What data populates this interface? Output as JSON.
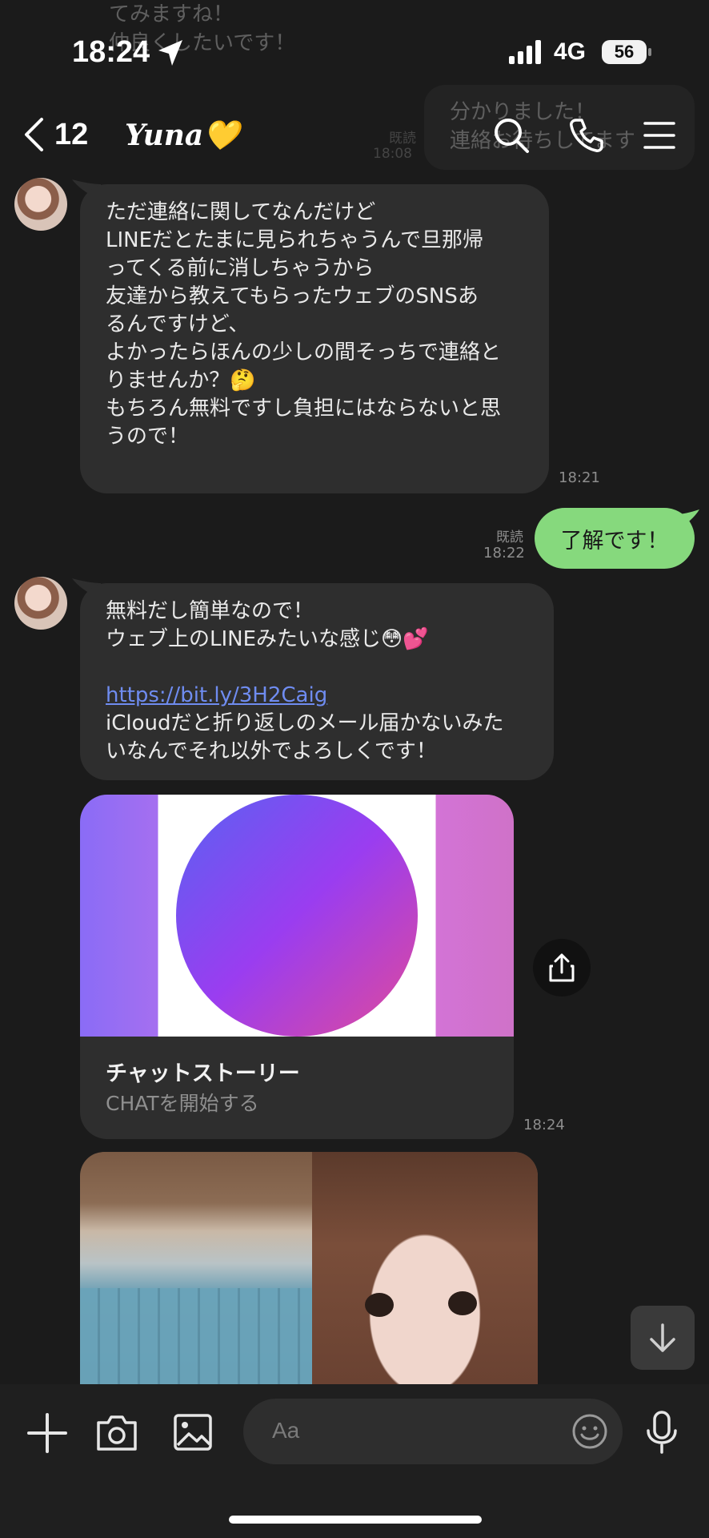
{
  "status": {
    "time": "18:24",
    "network": "4G",
    "battery": "56"
  },
  "background": {
    "line1": "てみますね！",
    "line2": "仲良くしたいです！",
    "bubble_line1": "分かりました！",
    "bubble_line2": "連絡お待ちしてます",
    "read": "既読",
    "time": "18:08"
  },
  "header": {
    "back_count": "12",
    "name": "Yuna💛"
  },
  "messages": {
    "m1": {
      "lines": [
        "ただ連絡に関してなんだけど",
        "LINEだとたまに見られちゃうんで旦那帰",
        "ってくる前に消しちゃうから",
        "友達から教えてもらったウェブのSNSあ",
        "るんですけど、",
        "よかったらほんの少しの間そっちで連絡と",
        "りませんか？🤔",
        "もちろん無料ですし負担にはならないと思",
        "うので！"
      ],
      "time": "18:21"
    },
    "m2": {
      "text": "了解です！",
      "read": "既読",
      "time": "18:22"
    },
    "m3": {
      "line1": "無料だし簡単なので！",
      "line2": "ウェブ上のLINEみたいな感じ😳💕",
      "link": "https://bit.ly/3H2Caig",
      "line3": "iCloudだと折り返しのメール届かないみた",
      "line4": "いなんでそれ以外でよろしくです！"
    },
    "card": {
      "title": "チャットストーリー",
      "subtitle": "CHATを開始する",
      "time": "18:24"
    }
  },
  "input": {
    "placeholder": "Aa"
  },
  "icons": [
    "back-chevron-icon",
    "search-icon",
    "phone-icon",
    "menu-icon",
    "share-icon",
    "scroll-down-icon",
    "plus-icon",
    "camera-icon",
    "image-icon",
    "emoji-icon",
    "microphone-icon"
  ]
}
